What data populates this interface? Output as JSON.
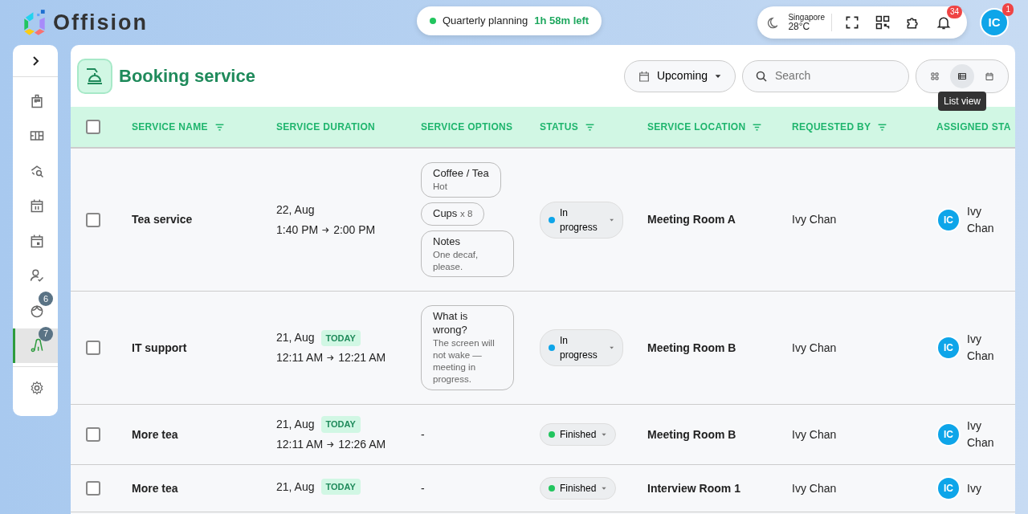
{
  "brand": {
    "name": "Offision"
  },
  "timer": {
    "label": "Quarterly planning",
    "remaining": "1h 58m left",
    "color": "#22c55e"
  },
  "weather": {
    "city": "Singapore",
    "temp": "28°C"
  },
  "toolbar": [
    {
      "kind": "fullscreen"
    },
    {
      "kind": "qr"
    },
    {
      "kind": "puzzle"
    },
    {
      "kind": "bell",
      "badge": "34"
    }
  ],
  "user": {
    "initials": "IC",
    "badge": "1"
  },
  "sidebar": {
    "items": [
      {
        "kind": "building",
        "selected": false
      },
      {
        "kind": "floorplan",
        "selected": false
      },
      {
        "kind": "room-search",
        "selected": false
      },
      {
        "kind": "calendar",
        "selected": false
      },
      {
        "kind": "calendar-day",
        "selected": false
      },
      {
        "kind": "person-check",
        "selected": false
      },
      {
        "kind": "visitor",
        "badge": "6",
        "selected": false
      },
      {
        "kind": "service",
        "badge": "7",
        "selected": true
      }
    ]
  },
  "page": {
    "title": "Booking service",
    "filter": "Upcoming",
    "search": {
      "placeholder": "Search"
    },
    "views": [
      {
        "kind": "grid",
        "selected": false
      },
      {
        "kind": "list",
        "selected": true,
        "tooltip": "List view"
      },
      {
        "kind": "calendar",
        "selected": false
      }
    ]
  },
  "table": {
    "all_checked": false,
    "columns": [
      {
        "label": "SERVICE NAME",
        "filterable": true
      },
      {
        "label": "SERVICE DURATION",
        "filterable": false
      },
      {
        "label": "SERVICE OPTIONS",
        "filterable": false
      },
      {
        "label": "STATUS",
        "filterable": true
      },
      {
        "label": "SERVICE LOCATION",
        "filterable": true
      },
      {
        "label": "REQUESTED BY",
        "filterable": true
      },
      {
        "label": "ASSIGNED STA",
        "filterable": false
      }
    ],
    "rows": [
      {
        "checked": false,
        "name": "Tea service",
        "date": "22, Aug",
        "today": false,
        "start": "1:40 PM",
        "end": "2:00 PM",
        "options": [
          {
            "kind": "detail",
            "title": "Coffee / Tea",
            "detail": "Hot"
          },
          {
            "kind": "count",
            "title": "Cups",
            "detail": "x 8"
          },
          {
            "kind": "detail",
            "title": "Notes",
            "detail": "One decaf, please."
          }
        ],
        "status": {
          "label": "In progress",
          "color": "#0ea5e9"
        },
        "location": "Meeting Room A",
        "requested_by": "Ivy Chan",
        "assigned": {
          "initials": "IC",
          "name": "Ivy Chan"
        }
      },
      {
        "checked": false,
        "name": "IT support",
        "date": "21, Aug",
        "today": true,
        "today_label": "TODAY",
        "start": "12:11 AM",
        "end": "12:21 AM",
        "options": [
          {
            "kind": "detail",
            "title": "What is wrong?",
            "detail": "The screen will not wake — meeting in progress."
          }
        ],
        "status": {
          "label": "In progress",
          "color": "#0ea5e9"
        },
        "location": "Meeting Room B",
        "requested_by": "Ivy Chan",
        "assigned": {
          "initials": "IC",
          "name": "Ivy Chan"
        }
      },
      {
        "checked": false,
        "name": "More tea",
        "date": "21, Aug",
        "today": true,
        "today_label": "TODAY",
        "start": "12:11 AM",
        "end": "12:26 AM",
        "no_options": "-",
        "status": {
          "label": "Finished",
          "color": "#22c55e"
        },
        "location": "Meeting Room B",
        "requested_by": "Ivy Chan",
        "assigned": {
          "initials": "IC",
          "name": "Ivy Chan"
        }
      },
      {
        "checked": false,
        "name": "More tea",
        "date": "21, Aug",
        "today": true,
        "today_label": "TODAY",
        "no_options": "-",
        "status": {
          "label": "Finished",
          "color": "#22c55e"
        },
        "location": "Interview Room 1",
        "requested_by": "Ivy Chan",
        "assigned": {
          "initials": "IC",
          "name": "Ivy"
        }
      }
    ]
  }
}
